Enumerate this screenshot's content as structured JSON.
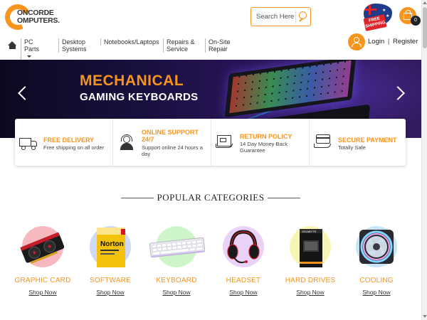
{
  "brand": {
    "logo_text_line1": "ONCORDE",
    "logo_text_line2": "OMPUTERS.",
    "logo_color": "#f7941d"
  },
  "search": {
    "placeholder": "Search Here"
  },
  "badge": {
    "free_label": "FREE SHIPPING"
  },
  "cart": {
    "count": "0"
  },
  "account": {
    "login_label": "Login",
    "separator": "|",
    "register_label": "Register"
  },
  "nav": {
    "items": [
      {
        "label": "PC Parts",
        "has_dropdown": true
      },
      {
        "label": "Desktop Systems"
      },
      {
        "label": "Notebooks/Laptops"
      },
      {
        "label": "Repairs & Service"
      },
      {
        "label": "On-Site Repair"
      }
    ]
  },
  "banner": {
    "title_line1": "MECHANICAL",
    "title_line2": "GAMING KEYBOARDS"
  },
  "features": [
    {
      "title": "FREE DELIVERY",
      "desc": "Free shipping on all order",
      "icon": "truck-icon"
    },
    {
      "title": "ONLINE SUPPORT 24/7",
      "desc": "Support online 24 hours a day",
      "icon": "support-agent-icon"
    },
    {
      "title": "RETURN POLICY",
      "desc": "14 Day Money Back Guarantee",
      "icon": "return-box-icon"
    },
    {
      "title": "SECURE PAYMENT",
      "desc": "Totally Safe",
      "icon": "card-payment-icon"
    }
  ],
  "categories_section": {
    "title": "POPULAR CATEGORIES",
    "items": [
      {
        "name": "GRAPHIC CARD",
        "link": "Shop Now",
        "circle_color": "#f7b8bf"
      },
      {
        "name": "SOFTWARE",
        "link": "Shop Now",
        "circle_color": "#cfd8f5"
      },
      {
        "name": "KEYBOARD",
        "link": "Shop Now",
        "circle_color": "#cdf5c9"
      },
      {
        "name": "HEADSET",
        "link": "Shop Now",
        "circle_color": "#ead2f7"
      },
      {
        "name": "HARD DRIVES",
        "link": "Shop Now",
        "circle_color": "#f7f5b5"
      },
      {
        "name": "COOLING",
        "link": "Shop Now",
        "circle_color": "#c9e4f7"
      }
    ]
  },
  "colors": {
    "accent": "#f7941d",
    "banner_bg": "#1a1040"
  }
}
